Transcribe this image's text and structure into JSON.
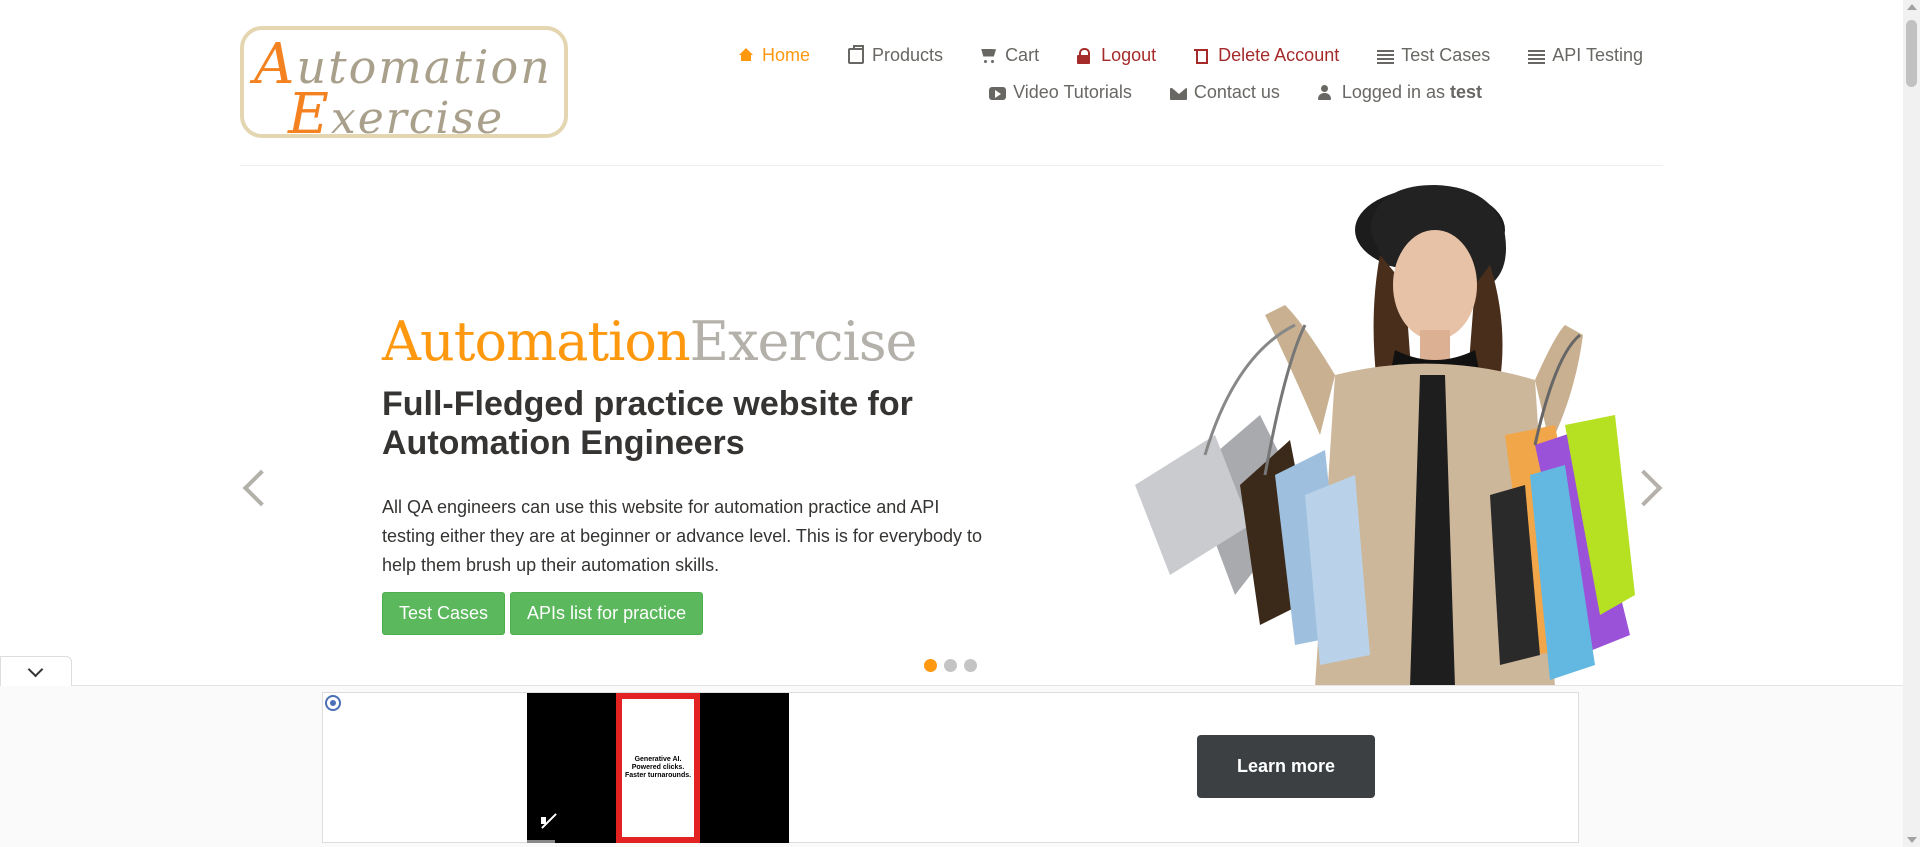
{
  "logo": {
    "line1_cap": "A",
    "line1_rest": "utomation",
    "line2_cap": "E",
    "line2_rest": "xercise"
  },
  "nav": {
    "row1": [
      {
        "label": "Home",
        "icon": "home-icon",
        "state": "active"
      },
      {
        "label": "Products",
        "icon": "briefcase-icon"
      },
      {
        "label": "Cart",
        "icon": "cart-icon"
      },
      {
        "label": "Logout",
        "icon": "lock-icon"
      },
      {
        "label": "Delete Account",
        "icon": "trash-icon"
      },
      {
        "label": "Test Cases",
        "icon": "list-icon"
      },
      {
        "label": "API Testing",
        "icon": "list-icon"
      }
    ],
    "row2": [
      {
        "label": "Video Tutorials",
        "icon": "youtube-icon"
      },
      {
        "label": "Contact us",
        "icon": "envelope-icon"
      },
      {
        "label": "Logged in as",
        "icon": "user-icon",
        "username": "test"
      }
    ]
  },
  "slider": {
    "brand_part1": "Automation",
    "brand_part2": "Exercise",
    "headline": "Full-Fledged practice website for Automation Engineers",
    "description": "All QA engineers can use this website for automation practice and API testing either they are at beginner or advance level. This is for everybody to help them brush up their automation skills.",
    "btn_test_cases": "Test Cases",
    "btn_apis": "APIs list for practice",
    "active_slide": 1,
    "slide_count": 3
  },
  "ad": {
    "video_text": "Generative AI. Powered clicks. Faster turnarounds.",
    "cta": "Learn more"
  },
  "colors": {
    "accent": "#fe980f",
    "danger": "#a52a2a",
    "button_green": "#5cb85c",
    "text": "#696763"
  }
}
